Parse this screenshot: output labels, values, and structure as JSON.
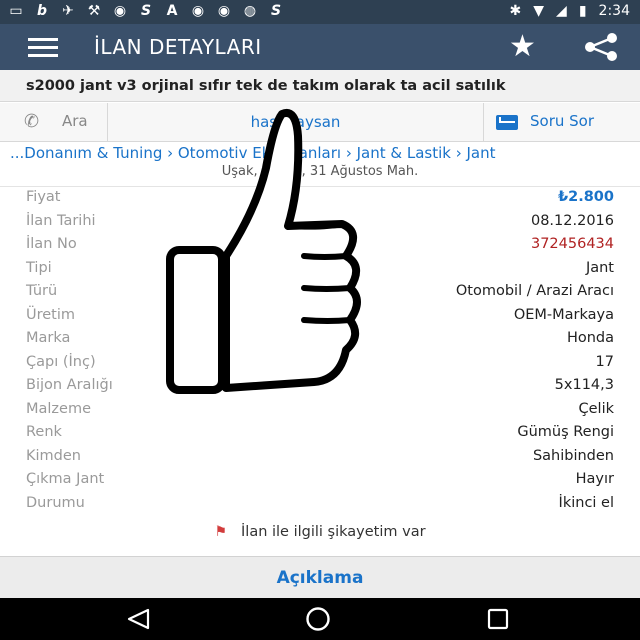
{
  "status": {
    "time": "2:34"
  },
  "header": {
    "title": "İLAN DETAYLARI"
  },
  "listing": {
    "title": "s2000 jant v3 orjinal sıfır tek de takım olarak ta acil satılık"
  },
  "actions": {
    "call_label": "Ara",
    "user_label": "hasanaysan",
    "ask_label": "Soru Sor"
  },
  "breadcrumb": "...Donanım & Tuning › Otomotiv Ekipmanları › Jant & Lastik › Jant",
  "location": "Uşak, Banaz, 31 Ağustos Mah.",
  "details": [
    {
      "label": "Fiyat",
      "value": "₺2.800"
    },
    {
      "label": "İlan Tarihi",
      "value": "08.12.2016"
    },
    {
      "label": "İlan No",
      "value": "372456434"
    },
    {
      "label": "Tipi",
      "value": "Jant"
    },
    {
      "label": "Türü",
      "value": "Otomobil / Arazi Aracı"
    },
    {
      "label": "Üretim",
      "value": "OEM-Markaya"
    },
    {
      "label": "Marka",
      "value": "Honda"
    },
    {
      "label": "Çapı (İnç)",
      "value": "17"
    },
    {
      "label": "Bijon Aralığı",
      "value": "5x114,3"
    },
    {
      "label": "Malzeme",
      "value": "Çelik"
    },
    {
      "label": "Renk",
      "value": "Gümüş Rengi"
    },
    {
      "label": "Kimden",
      "value": "Sahibinden"
    },
    {
      "label": "Çıkma Jant",
      "value": "Hayır"
    },
    {
      "label": "Durumu",
      "value": "İkinci el"
    }
  ],
  "complaint": "İlan ile ilgili şikayetim var",
  "footer": {
    "tab_label": "Açıklama"
  },
  "icons": {
    "menu": "hamburger-icon",
    "star": "star-icon",
    "share": "share-icon",
    "phone": "phone-icon",
    "mail": "mail-icon",
    "flag": "flag-icon",
    "overlay": "thumbs-up-icon"
  },
  "colors": {
    "appbar": "#3a506b",
    "link": "#1a73c9",
    "price": "#1a73c9",
    "ilan_no": "#b02222"
  }
}
